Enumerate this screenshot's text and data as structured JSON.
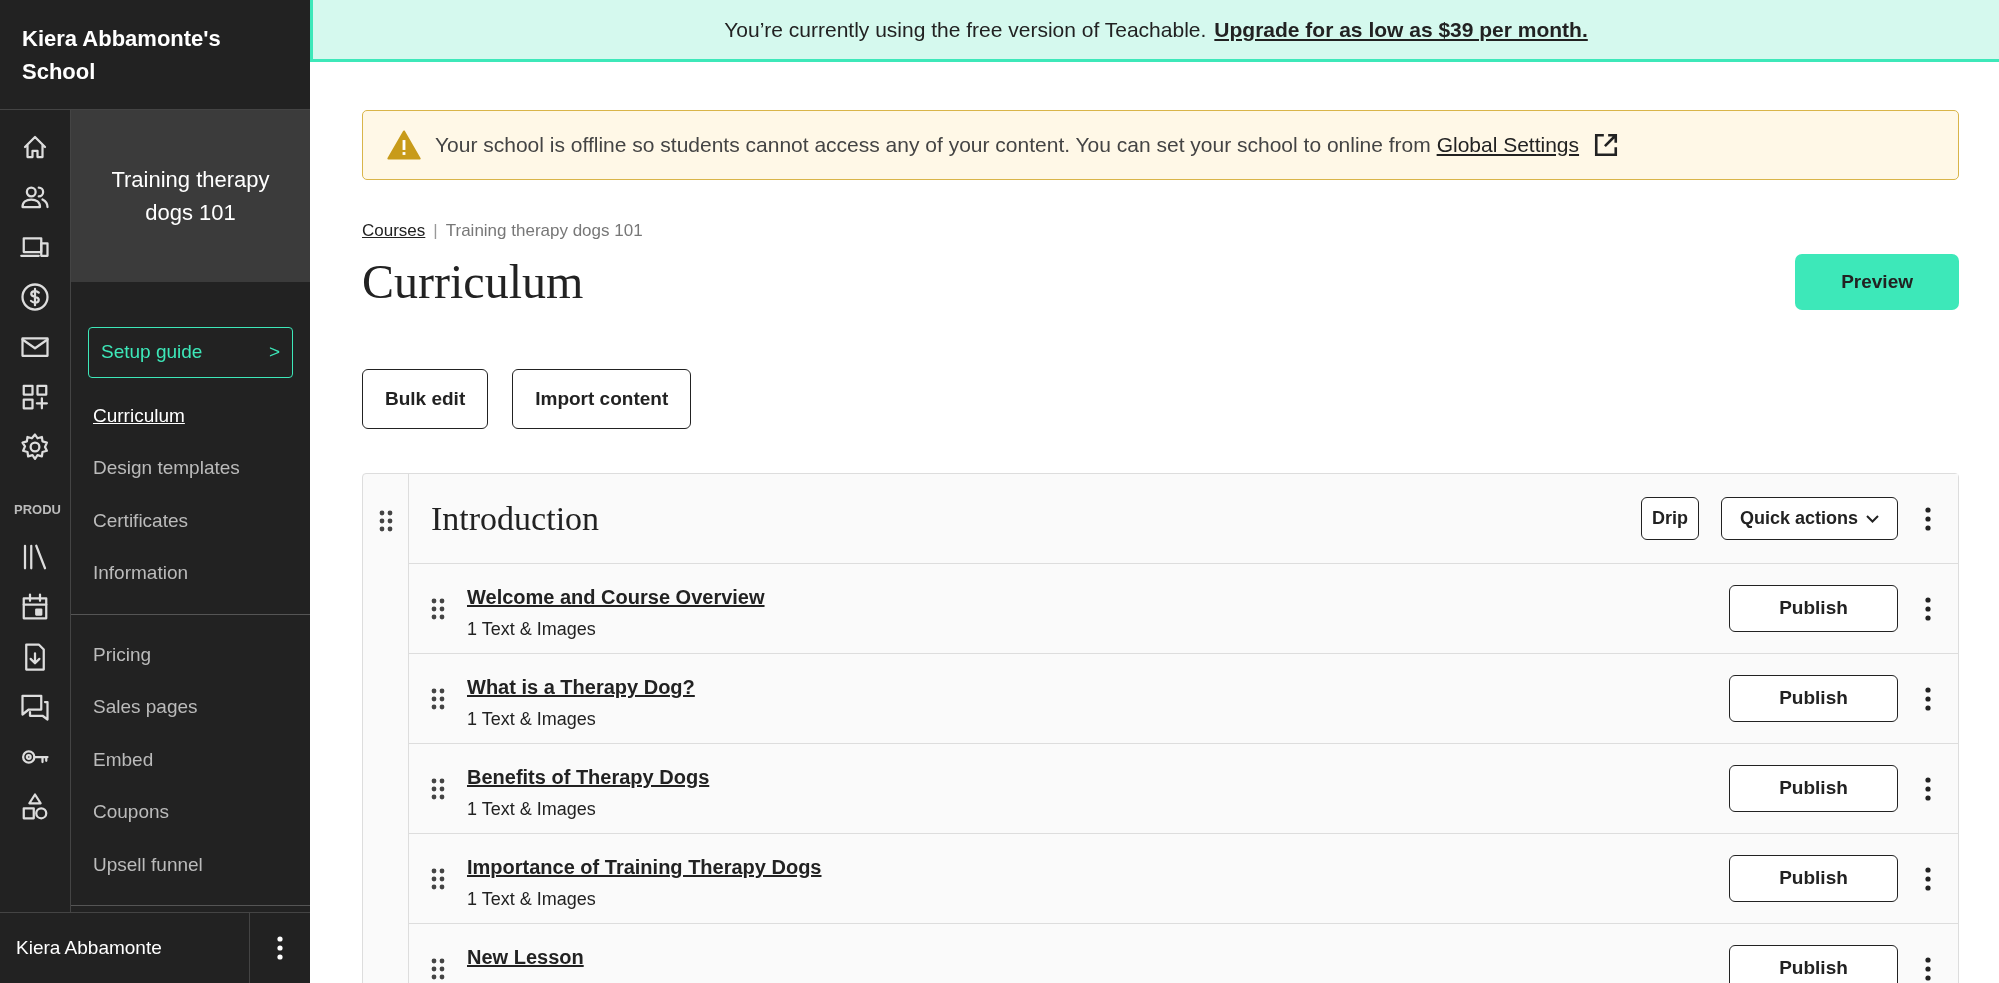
{
  "school_name": "Kiera Abbamonte's School",
  "rail": {
    "section_label": "PRODU"
  },
  "course_title": "Training therapy dogs 101",
  "setup_guide": {
    "label": "Setup guide",
    "arrow": ">"
  },
  "nav_groups": [
    [
      {
        "label": "Curriculum",
        "selected": true
      },
      {
        "label": "Design templates",
        "selected": false
      },
      {
        "label": "Certificates",
        "selected": false
      },
      {
        "label": "Information",
        "selected": false
      }
    ],
    [
      {
        "label": "Pricing",
        "selected": false
      },
      {
        "label": "Sales pages",
        "selected": false
      },
      {
        "label": "Embed",
        "selected": false
      },
      {
        "label": "Coupons",
        "selected": false
      },
      {
        "label": "Upsell funnel",
        "selected": false
      }
    ]
  ],
  "user_name": "Kiera Abbamonte",
  "banner": {
    "text": "You’re currently using the free version of Teachable.",
    "link": "Upgrade for as low as $39 per month."
  },
  "alert": {
    "text": "Your school is offline so students cannot access any of your content. You can set your school to online from",
    "link": "Global Settings"
  },
  "breadcrumb": {
    "link": "Courses",
    "separator": "|",
    "current": "Training therapy dogs 101"
  },
  "heading": "Curriculum",
  "preview_button": "Preview",
  "action_buttons": [
    "Bulk edit",
    "Import content"
  ],
  "section": {
    "title": "Introduction",
    "drip_button": "Drip",
    "quick_actions": "Quick actions",
    "lessons": [
      {
        "title": "Welcome and Course Overview",
        "subtitle": "1 Text & Images",
        "button": "Publish"
      },
      {
        "title": "What is a Therapy Dog?",
        "subtitle": "1 Text & Images",
        "button": "Publish"
      },
      {
        "title": "Benefits of Therapy Dogs",
        "subtitle": "1 Text & Images",
        "button": "Publish"
      },
      {
        "title": "Importance of Training Therapy Dogs",
        "subtitle": "1 Text & Images",
        "button": "Publish"
      },
      {
        "title": "New Lesson",
        "button": "Publish"
      }
    ]
  }
}
